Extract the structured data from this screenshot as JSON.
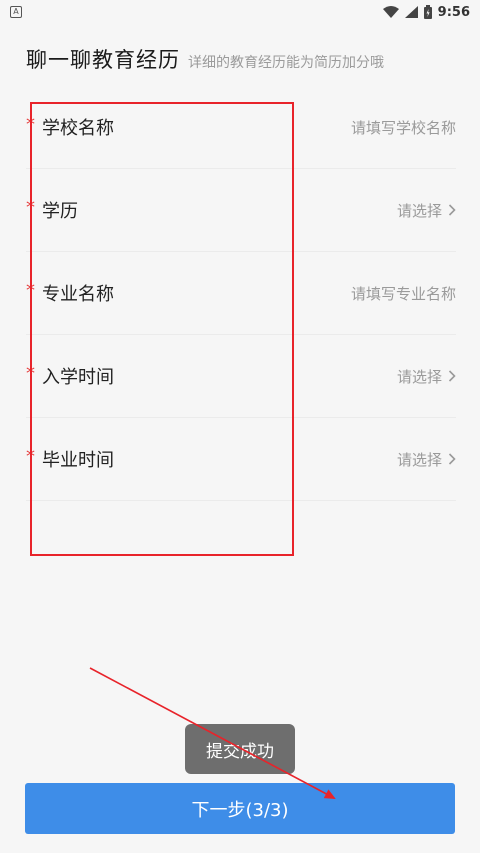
{
  "status_bar": {
    "left_icon": "A",
    "time": "9:56"
  },
  "header": {
    "title": "聊一聊教育经历",
    "subtitle": "详细的教育经历能为简历加分哦"
  },
  "form": {
    "required_mark": "*",
    "fields": [
      {
        "label": "学校名称",
        "placeholder": "请填写学校名称",
        "chevron": false
      },
      {
        "label": "学历",
        "placeholder": "请选择",
        "chevron": true
      },
      {
        "label": "专业名称",
        "placeholder": "请填写专业名称",
        "chevron": false
      },
      {
        "label": "入学时间",
        "placeholder": "请选择",
        "chevron": true
      },
      {
        "label": "毕业时间",
        "placeholder": "请选择",
        "chevron": true
      }
    ]
  },
  "toast": {
    "text": "提交成功"
  },
  "footer": {
    "next_label": "下一步(3/3)"
  },
  "colors": {
    "accent": "#3e8de8",
    "required": "#e53333",
    "annotation": "#e8232a"
  }
}
